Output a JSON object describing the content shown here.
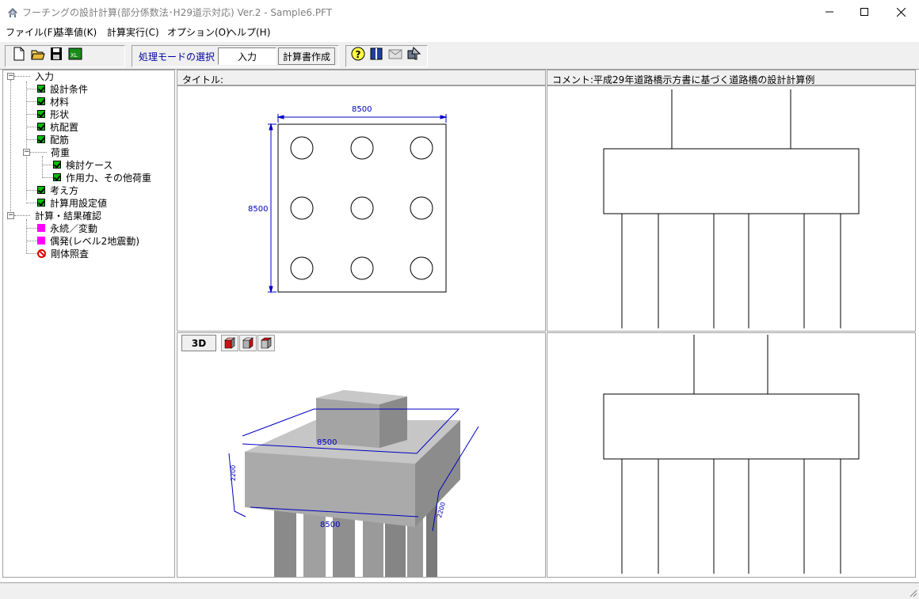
{
  "window": {
    "title": "フーチングの設計計算(部分係数法･H29道示対応) Ver.2 - Sample6.PFT",
    "controls": [
      "minimize-icon",
      "maximize-icon",
      "close-icon"
    ]
  },
  "menu": [
    {
      "label": "ファイル(F)"
    },
    {
      "label": "基準値(K)"
    },
    {
      "label": "計算実行(C)"
    },
    {
      "label": "オプション(O)"
    },
    {
      "label": "ヘルプ(H)"
    }
  ],
  "toolbar": {
    "file_icons": [
      "new-file-icon",
      "open-folder-icon",
      "save-icon",
      "export-icon"
    ],
    "mode_label": "処理モードの選択",
    "mode_input": "入力",
    "mode_report": "計算書作成",
    "help_icons": [
      "help-icon",
      "book-icon",
      "mail-icon",
      "settings-icon"
    ]
  },
  "tree": {
    "input_root": "入力",
    "items": [
      {
        "label": "設計条件",
        "state": "checked"
      },
      {
        "label": "材料",
        "state": "checked"
      },
      {
        "label": "形状",
        "state": "checked"
      },
      {
        "label": "杭配置",
        "state": "checked"
      },
      {
        "label": "配筋",
        "state": "checked"
      }
    ],
    "load_group": "荷重",
    "load_items": [
      {
        "label": "検討ケース",
        "state": "checked"
      },
      {
        "label": "作用力、その他荷重",
        "state": "checked"
      }
    ],
    "items2": [
      {
        "label": "考え方",
        "state": "checked"
      },
      {
        "label": "計算用設定値",
        "state": "checked"
      }
    ],
    "calc_root": "計算・結果確認",
    "calc_items": [
      {
        "label": "永続／変動",
        "state": "pending"
      },
      {
        "label": "偶発(レベル2地震動)",
        "state": "pending"
      },
      {
        "label": "剛体照査",
        "state": "none"
      }
    ]
  },
  "panels": {
    "title_label": "タイトル:",
    "comment_label": "コメント:平成29年道路橋示方書に基づく道路橋の設計計算例",
    "plan": {
      "width_dim": "8500",
      "height_dim": "8500",
      "piles_rows": 3,
      "piles_cols": 3
    },
    "view3d_button": "3D",
    "view3d_icons": [
      "cube-front-icon",
      "cube-side-icon",
      "cube-iso-icon"
    ],
    "view3d_dims": {
      "top": "8500",
      "bottom": "8500",
      "height": "2200",
      "side": "2200"
    }
  },
  "colors": {
    "dimension": "#0000c0",
    "check_green": "#00c000",
    "pending_magenta": "#ff00ff",
    "forbidden_red": "#e00000",
    "mode_label": "#0000a0"
  }
}
